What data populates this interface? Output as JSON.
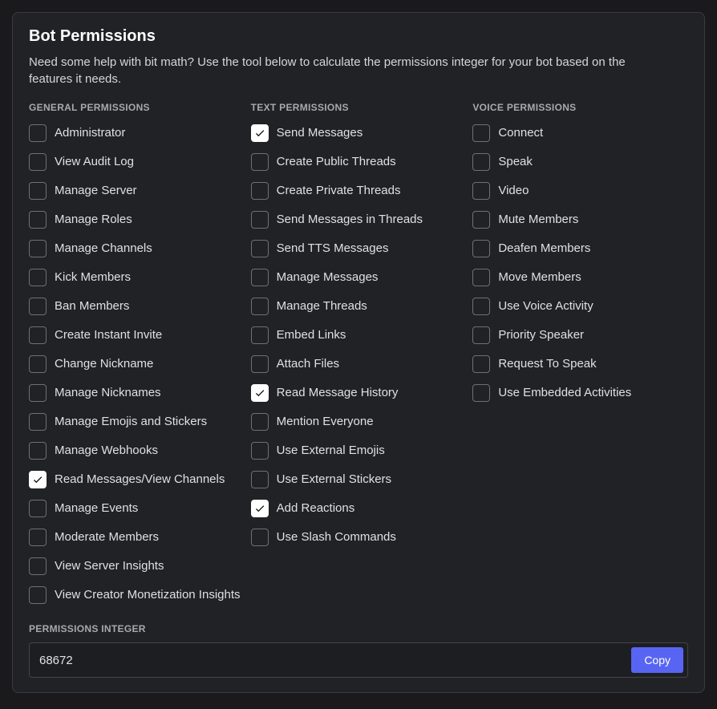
{
  "panel": {
    "title": "Bot Permissions",
    "description": "Need some help with bit math? Use the tool below to calculate the permissions integer for your bot based on the features it needs."
  },
  "columns": {
    "general": {
      "header": "GENERAL PERMISSIONS",
      "items": [
        {
          "label": "Administrator",
          "checked": false
        },
        {
          "label": "View Audit Log",
          "checked": false
        },
        {
          "label": "Manage Server",
          "checked": false
        },
        {
          "label": "Manage Roles",
          "checked": false
        },
        {
          "label": "Manage Channels",
          "checked": false
        },
        {
          "label": "Kick Members",
          "checked": false
        },
        {
          "label": "Ban Members",
          "checked": false
        },
        {
          "label": "Create Instant Invite",
          "checked": false
        },
        {
          "label": "Change Nickname",
          "checked": false
        },
        {
          "label": "Manage Nicknames",
          "checked": false
        },
        {
          "label": "Manage Emojis and Stickers",
          "checked": false
        },
        {
          "label": "Manage Webhooks",
          "checked": false
        },
        {
          "label": "Read Messages/View Channels",
          "checked": true
        },
        {
          "label": "Manage Events",
          "checked": false
        },
        {
          "label": "Moderate Members",
          "checked": false
        },
        {
          "label": "View Server Insights",
          "checked": false
        },
        {
          "label": "View Creator Monetization Insights",
          "checked": false
        }
      ]
    },
    "text": {
      "header": "TEXT PERMISSIONS",
      "items": [
        {
          "label": "Send Messages",
          "checked": true
        },
        {
          "label": "Create Public Threads",
          "checked": false
        },
        {
          "label": "Create Private Threads",
          "checked": false
        },
        {
          "label": "Send Messages in Threads",
          "checked": false
        },
        {
          "label": "Send TTS Messages",
          "checked": false
        },
        {
          "label": "Manage Messages",
          "checked": false
        },
        {
          "label": "Manage Threads",
          "checked": false
        },
        {
          "label": "Embed Links",
          "checked": false
        },
        {
          "label": "Attach Files",
          "checked": false
        },
        {
          "label": "Read Message History",
          "checked": true
        },
        {
          "label": "Mention Everyone",
          "checked": false
        },
        {
          "label": "Use External Emojis",
          "checked": false
        },
        {
          "label": "Use External Stickers",
          "checked": false
        },
        {
          "label": "Add Reactions",
          "checked": true
        },
        {
          "label": "Use Slash Commands",
          "checked": false
        }
      ]
    },
    "voice": {
      "header": "VOICE PERMISSIONS",
      "items": [
        {
          "label": "Connect",
          "checked": false
        },
        {
          "label": "Speak",
          "checked": false
        },
        {
          "label": "Video",
          "checked": false
        },
        {
          "label": "Mute Members",
          "checked": false
        },
        {
          "label": "Deafen Members",
          "checked": false
        },
        {
          "label": "Move Members",
          "checked": false
        },
        {
          "label": "Use Voice Activity",
          "checked": false
        },
        {
          "label": "Priority Speaker",
          "checked": false
        },
        {
          "label": "Request To Speak",
          "checked": false
        },
        {
          "label": "Use Embedded Activities",
          "checked": false
        }
      ]
    }
  },
  "integer": {
    "header": "PERMISSIONS INTEGER",
    "value": "68672",
    "copy_label": "Copy"
  }
}
